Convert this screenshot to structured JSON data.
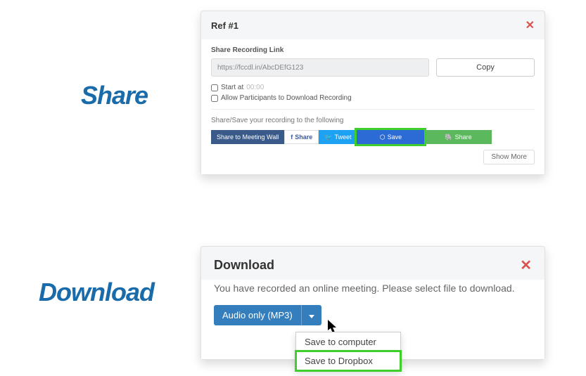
{
  "labels": {
    "share": "Share",
    "download": "Download"
  },
  "share_panel": {
    "title": "Ref #1",
    "section_label": "Share Recording Link",
    "link_value": "https://fccdl.in/AbcDEfG123",
    "copy_button": "Copy",
    "start_at_label": "Start at",
    "start_at_time": "00:00",
    "allow_download_label": "Allow Participants to Download Recording",
    "share_save_text": "Share/Save your recording to the following",
    "buttons": {
      "wall": "Share to Meeting Wall",
      "fb": "Share",
      "tw": "Tweet",
      "dropbox": "Save",
      "evernote": "Share"
    },
    "show_more": "Show More"
  },
  "download_panel": {
    "title": "Download",
    "message": "You have recorded an online meeting. Please select file to download.",
    "audio_button": "Audio only (MP3)",
    "menu": {
      "item1": "Save to computer",
      "item2": "Save to Dropbox"
    }
  }
}
